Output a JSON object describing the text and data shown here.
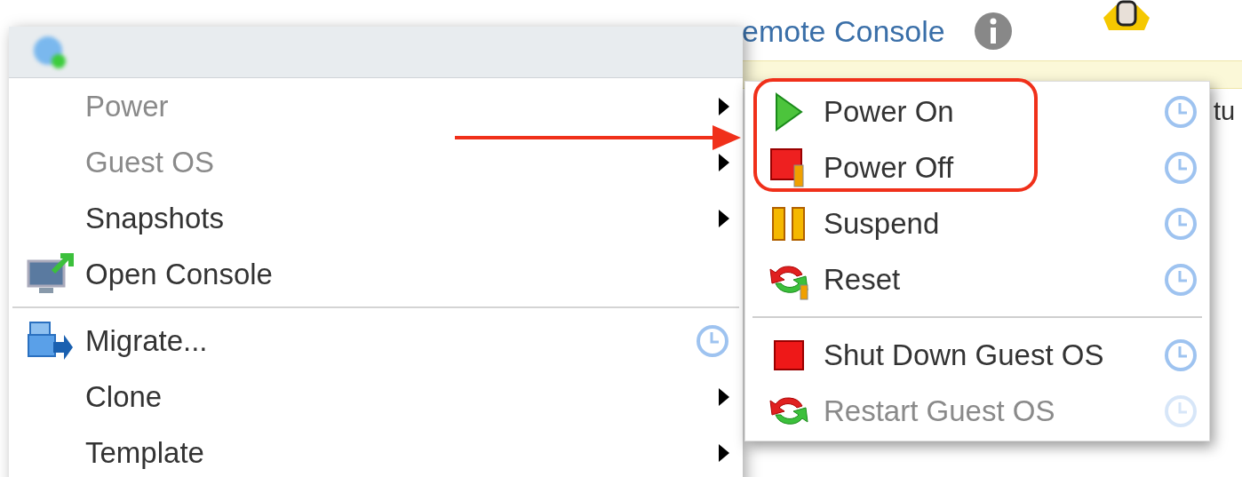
{
  "background": {
    "link": "emote Console",
    "cut_text": "tu"
  },
  "menu": {
    "items": [
      {
        "kind": "plain",
        "label": "Power",
        "disabled": true,
        "submenu": true,
        "scheduled": false
      },
      {
        "kind": "plain",
        "label": "Guest OS",
        "disabled": true,
        "submenu": true,
        "scheduled": false
      },
      {
        "kind": "plain",
        "label": "Snapshots",
        "disabled": false,
        "submenu": true,
        "scheduled": false
      },
      {
        "kind": "console",
        "label": "Open Console",
        "disabled": false,
        "submenu": false,
        "scheduled": false
      },
      {
        "kind": "separator"
      },
      {
        "kind": "migrate",
        "label": "Migrate...",
        "disabled": false,
        "submenu": false,
        "scheduled": true
      },
      {
        "kind": "plain",
        "label": "Clone",
        "disabled": false,
        "submenu": true,
        "scheduled": false
      },
      {
        "kind": "plain",
        "label": "Template",
        "disabled": false,
        "submenu": true,
        "scheduled": false
      }
    ]
  },
  "submenu": {
    "items": [
      {
        "kind": "play",
        "label": "Power On",
        "disabled": false,
        "scheduled": true
      },
      {
        "kind": "halt",
        "label": "Power Off",
        "disabled": false,
        "scheduled": true
      },
      {
        "kind": "pause",
        "label": "Suspend",
        "disabled": false,
        "scheduled": true
      },
      {
        "kind": "reset",
        "label": "Reset",
        "disabled": false,
        "scheduled": true
      },
      {
        "kind": "separator"
      },
      {
        "kind": "stop",
        "label": "Shut Down Guest OS",
        "disabled": false,
        "scheduled": true
      },
      {
        "kind": "restart",
        "label": "Restart Guest OS",
        "disabled": true,
        "scheduled": true
      }
    ]
  }
}
